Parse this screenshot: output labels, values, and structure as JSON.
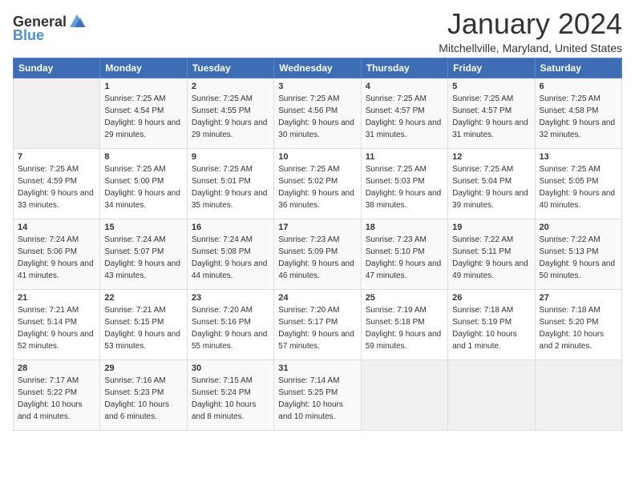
{
  "header": {
    "logo": {
      "text1": "General",
      "text2": "Blue"
    },
    "title": "January 2024",
    "location": "Mitchellville, Maryland, United States"
  },
  "weekdays": [
    "Sunday",
    "Monday",
    "Tuesday",
    "Wednesday",
    "Thursday",
    "Friday",
    "Saturday"
  ],
  "weeks": [
    [
      {
        "day": "",
        "empty": true
      },
      {
        "day": "1",
        "sunrise": "7:25 AM",
        "sunset": "4:54 PM",
        "daylight": "9 hours and 29 minutes."
      },
      {
        "day": "2",
        "sunrise": "7:25 AM",
        "sunset": "4:55 PM",
        "daylight": "9 hours and 29 minutes."
      },
      {
        "day": "3",
        "sunrise": "7:25 AM",
        "sunset": "4:56 PM",
        "daylight": "9 hours and 30 minutes."
      },
      {
        "day": "4",
        "sunrise": "7:25 AM",
        "sunset": "4:57 PM",
        "daylight": "9 hours and 31 minutes."
      },
      {
        "day": "5",
        "sunrise": "7:25 AM",
        "sunset": "4:57 PM",
        "daylight": "9 hours and 31 minutes."
      },
      {
        "day": "6",
        "sunrise": "7:25 AM",
        "sunset": "4:58 PM",
        "daylight": "9 hours and 32 minutes."
      }
    ],
    [
      {
        "day": "7",
        "sunrise": "7:25 AM",
        "sunset": "4:59 PM",
        "daylight": "9 hours and 33 minutes."
      },
      {
        "day": "8",
        "sunrise": "7:25 AM",
        "sunset": "5:00 PM",
        "daylight": "9 hours and 34 minutes."
      },
      {
        "day": "9",
        "sunrise": "7:25 AM",
        "sunset": "5:01 PM",
        "daylight": "9 hours and 35 minutes."
      },
      {
        "day": "10",
        "sunrise": "7:25 AM",
        "sunset": "5:02 PM",
        "daylight": "9 hours and 36 minutes."
      },
      {
        "day": "11",
        "sunrise": "7:25 AM",
        "sunset": "5:03 PM",
        "daylight": "9 hours and 38 minutes."
      },
      {
        "day": "12",
        "sunrise": "7:25 AM",
        "sunset": "5:04 PM",
        "daylight": "9 hours and 39 minutes."
      },
      {
        "day": "13",
        "sunrise": "7:25 AM",
        "sunset": "5:05 PM",
        "daylight": "9 hours and 40 minutes."
      }
    ],
    [
      {
        "day": "14",
        "sunrise": "7:24 AM",
        "sunset": "5:06 PM",
        "daylight": "9 hours and 41 minutes."
      },
      {
        "day": "15",
        "sunrise": "7:24 AM",
        "sunset": "5:07 PM",
        "daylight": "9 hours and 43 minutes."
      },
      {
        "day": "16",
        "sunrise": "7:24 AM",
        "sunset": "5:08 PM",
        "daylight": "9 hours and 44 minutes."
      },
      {
        "day": "17",
        "sunrise": "7:23 AM",
        "sunset": "5:09 PM",
        "daylight": "9 hours and 46 minutes."
      },
      {
        "day": "18",
        "sunrise": "7:23 AM",
        "sunset": "5:10 PM",
        "daylight": "9 hours and 47 minutes."
      },
      {
        "day": "19",
        "sunrise": "7:22 AM",
        "sunset": "5:11 PM",
        "daylight": "9 hours and 49 minutes."
      },
      {
        "day": "20",
        "sunrise": "7:22 AM",
        "sunset": "5:13 PM",
        "daylight": "9 hours and 50 minutes."
      }
    ],
    [
      {
        "day": "21",
        "sunrise": "7:21 AM",
        "sunset": "5:14 PM",
        "daylight": "9 hours and 52 minutes."
      },
      {
        "day": "22",
        "sunrise": "7:21 AM",
        "sunset": "5:15 PM",
        "daylight": "9 hours and 53 minutes."
      },
      {
        "day": "23",
        "sunrise": "7:20 AM",
        "sunset": "5:16 PM",
        "daylight": "9 hours and 55 minutes."
      },
      {
        "day": "24",
        "sunrise": "7:20 AM",
        "sunset": "5:17 PM",
        "daylight": "9 hours and 57 minutes."
      },
      {
        "day": "25",
        "sunrise": "7:19 AM",
        "sunset": "5:18 PM",
        "daylight": "9 hours and 59 minutes."
      },
      {
        "day": "26",
        "sunrise": "7:18 AM",
        "sunset": "5:19 PM",
        "daylight": "10 hours and 1 minute."
      },
      {
        "day": "27",
        "sunrise": "7:18 AM",
        "sunset": "5:20 PM",
        "daylight": "10 hours and 2 minutes."
      }
    ],
    [
      {
        "day": "28",
        "sunrise": "7:17 AM",
        "sunset": "5:22 PM",
        "daylight": "10 hours and 4 minutes."
      },
      {
        "day": "29",
        "sunrise": "7:16 AM",
        "sunset": "5:23 PM",
        "daylight": "10 hours and 6 minutes."
      },
      {
        "day": "30",
        "sunrise": "7:15 AM",
        "sunset": "5:24 PM",
        "daylight": "10 hours and 8 minutes."
      },
      {
        "day": "31",
        "sunrise": "7:14 AM",
        "sunset": "5:25 PM",
        "daylight": "10 hours and 10 minutes."
      },
      {
        "day": "",
        "empty": true
      },
      {
        "day": "",
        "empty": true
      },
      {
        "day": "",
        "empty": true
      }
    ]
  ]
}
